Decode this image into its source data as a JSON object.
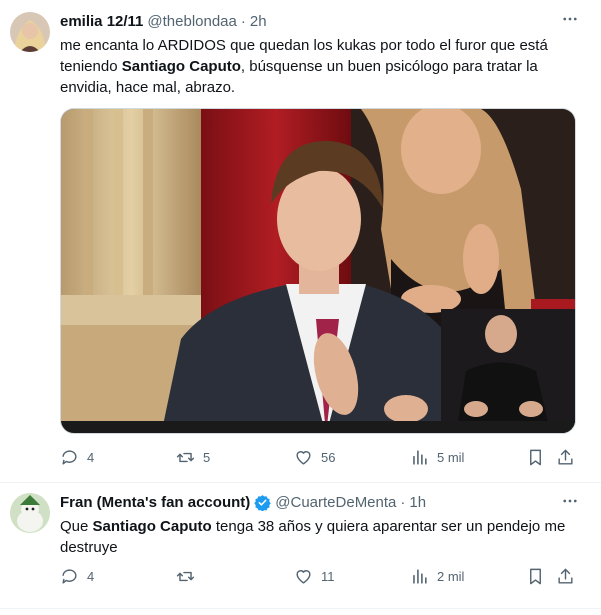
{
  "tweets": [
    {
      "name": "emilia 12/11",
      "handle": "@theblondaa",
      "separator": "·",
      "time": "2h",
      "text_parts": [
        "me encanta lo ARDIDOS que quedan los kukas por todo el furor que está teniendo ",
        "Santiago Caputo",
        ", búsquense un buen psicólogo para tratar la envidia, hace mal, abrazo."
      ],
      "actions": {
        "replies": "4",
        "reposts": "5",
        "likes": "56",
        "views": "5 mil"
      }
    },
    {
      "name": "Fran (Menta's fan account)",
      "handle": "@CuarteDeMenta",
      "separator": "·",
      "time": "1h",
      "text_parts": [
        "Que ",
        "Santiago Caputo",
        " tenga 38 años y quiera aparentar ser un pendejo me destruye"
      ],
      "actions": {
        "replies": "4",
        "reposts": "",
        "likes": "11",
        "views": "2 mil"
      }
    }
  ],
  "colors": {
    "verified": "#1d9bf0",
    "muted": "#536471",
    "text": "#0f1419"
  }
}
